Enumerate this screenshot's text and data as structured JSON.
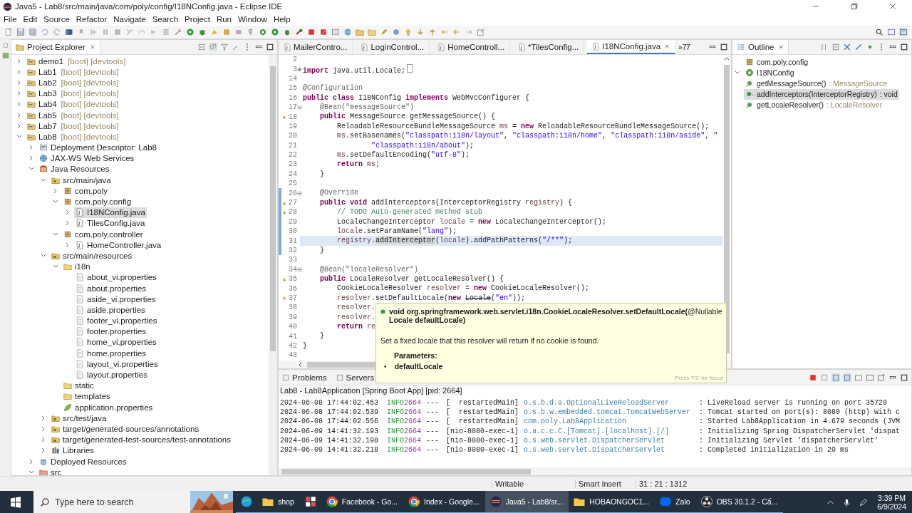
{
  "window": {
    "title": "Java5 - Lab8/src/main/java/com/poly/config/I18NConfig.java - Eclipse IDE"
  },
  "menu": [
    "File",
    "Edit",
    "Source",
    "Refactor",
    "Navigate",
    "Search",
    "Project",
    "Run",
    "Window",
    "Help"
  ],
  "explorer": {
    "title": "Project Explorer",
    "items": [
      {
        "label": "demo1",
        "decoration": "[boot] [devtools]",
        "kind": "project",
        "expanded": false,
        "selected": false
      },
      {
        "label": "Lab1",
        "decoration": "[boot] [devtools]",
        "kind": "project",
        "expanded": false,
        "selected": false
      },
      {
        "label": "Lab2",
        "decoration": "[boot] [devtools]",
        "kind": "project",
        "expanded": false,
        "selected": false
      },
      {
        "label": "Lab3",
        "decoration": "[boot] [devtools]",
        "kind": "project",
        "expanded": false,
        "selected": false
      },
      {
        "label": "Lab4",
        "decoration": "[boot] [devtools]",
        "kind": "project",
        "expanded": false,
        "selected": false
      },
      {
        "label": "Lab5",
        "decoration": "[boot] [devtools]",
        "kind": "project",
        "expanded": false,
        "selected": false
      },
      {
        "label": "Lab7",
        "decoration": "[boot] [devtools]",
        "kind": "project",
        "expanded": false,
        "selected": false
      },
      {
        "label": "Lab8",
        "decoration": "[boot] [devtools]",
        "kind": "project",
        "expanded": true,
        "selected": false,
        "children": [
          {
            "label": "Deployment Descriptor: Lab8",
            "kind": "descriptor",
            "expanded": false,
            "selected": false
          },
          {
            "label": "JAX-WS Web Services",
            "kind": "webservice",
            "expanded": false,
            "selected": false
          },
          {
            "label": "Java Resources",
            "kind": "javares",
            "expanded": true,
            "selected": false,
            "children": [
              {
                "label": "src/main/java",
                "kind": "srcfolder",
                "expanded": true,
                "selected": false,
                "children": [
                  {
                    "label": "com.poly",
                    "kind": "package",
                    "expanded": false,
                    "selected": false
                  },
                  {
                    "label": "com.poly.config",
                    "kind": "package",
                    "expanded": true,
                    "selected": false,
                    "children": [
                      {
                        "label": "I18NConfig.java",
                        "kind": "java",
                        "expanded": false,
                        "selected": true
                      },
                      {
                        "label": "TilesConfig.java",
                        "kind": "java",
                        "expanded": false,
                        "selected": false
                      }
                    ]
                  },
                  {
                    "label": "com.poly.controller",
                    "kind": "package",
                    "expanded": true,
                    "selected": false,
                    "children": [
                      {
                        "label": "HomeController.java",
                        "kind": "java",
                        "expanded": false,
                        "selected": false
                      }
                    ]
                  }
                ]
              },
              {
                "label": "src/main/resources",
                "kind": "srcfolder",
                "expanded": true,
                "selected": false,
                "children": [
                  {
                    "label": "i18n",
                    "kind": "folder",
                    "expanded": true,
                    "selected": false,
                    "children": [
                      {
                        "label": "about_vi.properties",
                        "kind": "file",
                        "selected": false
                      },
                      {
                        "label": "about.properties",
                        "kind": "file",
                        "selected": false
                      },
                      {
                        "label": "aside_vi.properties",
                        "kind": "file",
                        "selected": false
                      },
                      {
                        "label": "aside.properties",
                        "kind": "file",
                        "selected": false
                      },
                      {
                        "label": "footer_vi.properties",
                        "kind": "file",
                        "selected": false
                      },
                      {
                        "label": "footer.properties",
                        "kind": "file",
                        "selected": false
                      },
                      {
                        "label": "home_vi.properties",
                        "kind": "file",
                        "selected": false
                      },
                      {
                        "label": "home.properties",
                        "kind": "file",
                        "selected": false
                      },
                      {
                        "label": "layout_vi.properties",
                        "kind": "file",
                        "selected": false
                      },
                      {
                        "label": "layout.properties",
                        "kind": "file",
                        "selected": false
                      }
                    ]
                  },
                  {
                    "label": "static",
                    "kind": "folder",
                    "selected": false
                  },
                  {
                    "label": "templates",
                    "kind": "folder",
                    "selected": false
                  },
                  {
                    "label": "application.properties",
                    "kind": "leaf",
                    "selected": false
                  }
                ]
              },
              {
                "label": "src/test/java",
                "kind": "srcfolder",
                "expanded": false,
                "selected": false
              },
              {
                "label": "target/generated-sources/annotations",
                "kind": "srcfolder",
                "expanded": false,
                "selected": false
              },
              {
                "label": "target/generated-test-sources/test-annotations",
                "kind": "srcfolder",
                "expanded": false,
                "selected": false
              },
              {
                "label": "Libraries",
                "kind": "libraries",
                "expanded": false,
                "selected": false
              }
            ]
          },
          {
            "label": "Deployed Resources",
            "kind": "deployed",
            "expanded": false,
            "selected": false
          },
          {
            "label": "src",
            "kind": "src",
            "expanded": true,
            "selected": false
          }
        ]
      }
    ]
  },
  "editor": {
    "tabs": [
      {
        "label": "MailerContro...",
        "selected": false
      },
      {
        "label": "LoginControl...",
        "selected": false
      },
      {
        "label": "HomeControll...",
        "selected": false
      },
      {
        "label": "*TilesConfig...",
        "selected": false
      },
      {
        "label": "I18NConfig.java",
        "selected": true
      }
    ],
    "overflow": "»77",
    "lines": [
      {
        "num": "2",
        "changed": false,
        "flagged": false,
        "current": false
      },
      {
        "num": "3",
        "folded": true,
        "changed": false,
        "flagged": false,
        "current": false,
        "tokens": [
          {
            "kind": "kw",
            "text": "import"
          },
          {
            "kind": "plain",
            "text": " java.util.Locale;"
          }
        ]
      },
      {
        "num": "14",
        "changed": false,
        "flagged": false,
        "current": false
      },
      {
        "num": "15",
        "changed": false,
        "flagged": false,
        "current": false,
        "tokens": [
          {
            "kind": "ann",
            "text": "@Configuration"
          }
        ]
      },
      {
        "num": "16",
        "changed": false,
        "flagged": false,
        "current": false,
        "tokens": [
          {
            "kind": "kw",
            "text": "public class"
          },
          {
            "kind": "plain",
            "text": " I18NConfig "
          },
          {
            "kind": "kw",
            "text": "implements"
          },
          {
            "kind": "plain",
            "text": " WebMvcConfigurer {"
          }
        ]
      },
      {
        "num": "17",
        "folded": false,
        "changed": false,
        "flagged": false,
        "current": false,
        "tokens": [
          {
            "kind": "ann",
            "text": "    @Bean(\"messageSource\")"
          }
        ]
      },
      {
        "num": "18",
        "changed": false,
        "flagged": true,
        "current": false,
        "tokens": [
          {
            "kind": "kw",
            "text": "    public"
          },
          {
            "kind": "plain",
            "text": " MessageSource getMessageSource() {"
          }
        ]
      },
      {
        "num": "19",
        "changed": false,
        "flagged": false,
        "current": false,
        "tokens": [
          {
            "kind": "plain",
            "text": "        ReloadableResourceBundleMessageSource "
          },
          {
            "kind": "var",
            "text": "ms"
          },
          {
            "kind": "plain",
            "text": " = "
          },
          {
            "kind": "kw",
            "text": "new"
          },
          {
            "kind": "plain",
            "text": " ReloadableResourceBundleMessageSource();"
          }
        ]
      },
      {
        "num": "20",
        "changed": false,
        "flagged": false,
        "current": false,
        "tokens": [
          {
            "kind": "var",
            "text": "        ms"
          },
          {
            "kind": "plain",
            "text": ".setBasenames("
          },
          {
            "kind": "str",
            "text": "\"classpath:i18n/layout\""
          },
          {
            "kind": "plain",
            "text": ", "
          },
          {
            "kind": "str",
            "text": "\"classpath:i18n/home\""
          },
          {
            "kind": "plain",
            "text": ", "
          },
          {
            "kind": "str",
            "text": "\"classpath:i18n/aside\""
          },
          {
            "kind": "plain",
            "text": ", "
          },
          {
            "kind": "str",
            "text": "\""
          }
        ]
      },
      {
        "num": "21",
        "changed": false,
        "flagged": false,
        "current": false,
        "tokens": [
          {
            "kind": "str",
            "text": "                \"classpath:i18n/about\""
          },
          {
            "kind": "plain",
            "text": ");"
          }
        ]
      },
      {
        "num": "22",
        "changed": false,
        "flagged": false,
        "current": false,
        "tokens": [
          {
            "kind": "var",
            "text": "        ms"
          },
          {
            "kind": "plain",
            "text": ".setDefaultEncoding("
          },
          {
            "kind": "str",
            "text": "\"utf-8\""
          },
          {
            "kind": "plain",
            "text": ");"
          }
        ]
      },
      {
        "num": "23",
        "changed": false,
        "flagged": false,
        "current": false,
        "tokens": [
          {
            "kind": "kw",
            "text": "        return"
          },
          {
            "kind": "var",
            "text": " ms"
          },
          {
            "kind": "plain",
            "text": ";"
          }
        ]
      },
      {
        "num": "24",
        "changed": false,
        "flagged": false,
        "current": false,
        "tokens": [
          {
            "kind": "plain",
            "text": "    }"
          }
        ]
      },
      {
        "num": "25",
        "changed": false,
        "flagged": false,
        "current": false
      },
      {
        "num": "26",
        "folded": false,
        "changed": true,
        "flagged": false,
        "current": false,
        "tokens": [
          {
            "kind": "ann",
            "text": "    @Override"
          }
        ]
      },
      {
        "num": "27",
        "changed": true,
        "flagged": true,
        "current": false,
        "tokens": [
          {
            "kind": "kw",
            "text": "    public void"
          },
          {
            "kind": "plain",
            "text": " addInterceptors(InterceptorRegistry "
          },
          {
            "kind": "var",
            "text": "registry"
          },
          {
            "kind": "plain",
            "text": ") {"
          }
        ]
      },
      {
        "num": "28",
        "changed": true,
        "flagged": true,
        "current": false,
        "tokens": [
          {
            "kind": "cm",
            "text": "        // TODO Auto-generated method stub"
          }
        ]
      },
      {
        "num": "29",
        "changed": true,
        "flagged": false,
        "current": false,
        "tokens": [
          {
            "kind": "plain",
            "text": "        LocaleChangeInterceptor "
          },
          {
            "kind": "var",
            "text": "locale"
          },
          {
            "kind": "plain",
            "text": " = "
          },
          {
            "kind": "kw",
            "text": "new"
          },
          {
            "kind": "plain",
            "text": " LocaleChangeInterceptor();"
          }
        ]
      },
      {
        "num": "30",
        "changed": true,
        "flagged": false,
        "current": false,
        "tokens": [
          {
            "kind": "var",
            "text": "        locale"
          },
          {
            "kind": "plain",
            "text": ".setParamName("
          },
          {
            "kind": "str",
            "text": "\"lang\""
          },
          {
            "kind": "plain",
            "text": ");"
          }
        ]
      },
      {
        "num": "31",
        "changed": true,
        "flagged": false,
        "current": true,
        "tokens": [
          {
            "kind": "var",
            "text": "        registry"
          },
          {
            "kind": "plain",
            "text": "."
          },
          {
            "kind": "mark",
            "text": "addInterceptor"
          },
          {
            "kind": "plain",
            "text": "("
          },
          {
            "kind": "var",
            "text": "locale"
          },
          {
            "kind": "plain",
            "text": ").addPathPatterns("
          },
          {
            "kind": "str",
            "text": "\"/**\""
          },
          {
            "kind": "plain",
            "text": ");"
          }
        ]
      },
      {
        "num": "32",
        "changed": true,
        "flagged": false,
        "current": false,
        "tokens": [
          {
            "kind": "plain",
            "text": "    }"
          }
        ]
      },
      {
        "num": "33",
        "changed": false,
        "flagged": false,
        "current": false
      },
      {
        "num": "34",
        "folded": false,
        "changed": false,
        "flagged": false,
        "current": false,
        "tokens": [
          {
            "kind": "ann",
            "text": "    @Bean(\"localeResolver\")"
          }
        ]
      },
      {
        "num": "35",
        "changed": false,
        "flagged": true,
        "current": false,
        "tokens": [
          {
            "kind": "kw",
            "text": "    public"
          },
          {
            "kind": "plain",
            "text": " LocaleResolver getLocaleResolver() {"
          }
        ]
      },
      {
        "num": "36",
        "changed": false,
        "flagged": false,
        "current": false,
        "tokens": [
          {
            "kind": "plain",
            "text": "        CookieLocaleResolver "
          },
          {
            "kind": "var",
            "text": "resolver"
          },
          {
            "kind": "plain",
            "text": " = "
          },
          {
            "kind": "kw",
            "text": "new"
          },
          {
            "kind": "plain",
            "text": " CookieLocaleResolver();"
          }
        ]
      },
      {
        "num": "37",
        "changed": false,
        "flagged": true,
        "current": false,
        "tokens": [
          {
            "kind": "var",
            "text": "        resolver"
          },
          {
            "kind": "plain",
            "text": ".setDefaultLocale("
          },
          {
            "kind": "kw",
            "text": "new "
          },
          {
            "kind": "dep",
            "text": "Locale"
          },
          {
            "kind": "plain",
            "text": "("
          },
          {
            "kind": "str",
            "text": "\"en\""
          },
          {
            "kind": "plain",
            "text": "));"
          }
        ]
      },
      {
        "num": "38",
        "changed": false,
        "flagged": false,
        "current": false,
        "tokens": [
          {
            "kind": "var",
            "text": "        resolver"
          },
          {
            "kind": "plain",
            "text": "."
          }
        ]
      },
      {
        "num": "39",
        "changed": false,
        "flagged": false,
        "current": false,
        "tokens": [
          {
            "kind": "var",
            "text": "        resolver"
          },
          {
            "kind": "plain",
            "text": "."
          }
        ]
      },
      {
        "num": "40",
        "changed": false,
        "flagged": false,
        "current": false,
        "tokens": [
          {
            "kind": "kw",
            "text": "        return"
          },
          {
            "kind": "var",
            "text": " re"
          }
        ]
      },
      {
        "num": "41",
        "changed": false,
        "flagged": false,
        "current": false,
        "tokens": [
          {
            "kind": "plain",
            "text": "    }"
          }
        ]
      },
      {
        "num": "42",
        "changed": false,
        "flagged": false,
        "current": false,
        "tokens": [
          {
            "kind": "plain",
            "text": "}"
          }
        ]
      },
      {
        "num": "43",
        "changed": false,
        "flagged": false,
        "current": false
      }
    ]
  },
  "tooltip": {
    "signature": "**void org.springframework.web.servlet.i18n.CookieLocaleResolver.setDefaultLocale(**@Nullable **Locale defaultLocale)**",
    "description": "Set a fixed locale that this resolver will return if no cookie is found.",
    "params_heading": "Parameters:",
    "params": [
      {
        "bullet": "•",
        "name": "defaultLocale"
      }
    ],
    "hint": "Press 'F2' for focus"
  },
  "outline": {
    "title": "Outline",
    "items": [
      {
        "label": "com.poly.config",
        "kind": "package",
        "selected": false
      },
      {
        "label": "I18NConfig",
        "kind": "class",
        "expanded": true,
        "selected": false,
        "children": [
          {
            "label": "getMessageSource()",
            "type": " : MessageSource",
            "kind": "method",
            "selected": false
          },
          {
            "label": "addInterceptors(InterceptorRegistry)",
            "type": " : void",
            "kind": "method-public",
            "selected": true
          },
          {
            "label": "getLocaleResolver()",
            "type": " : LocaleResolver",
            "kind": "method",
            "selected": false
          }
        ]
      }
    ]
  },
  "console": {
    "tabs": [
      {
        "label": "Problems",
        "selected": false
      },
      {
        "label": "Servers",
        "selected": false
      }
    ],
    "process": "Lab8 - Lab8Application [Spring Boot App]  [pid: 2664]",
    "rows": [
      {
        "date": "2024-06-08 17:44:02.453",
        "level": "INFO",
        "pid": "2664",
        "sep": "---",
        "thread": "[  restartedMain]",
        "logger": "o.s.b.d.a.OptionalLiveReloadServer",
        "message": ": LiveReload server is running on port 35729"
      },
      {
        "date": "2024-06-08 17:44:02.539",
        "level": "INFO",
        "pid": "2664",
        "sep": "---",
        "thread": "[  restartedMain]",
        "logger": "o.s.b.w.embedded.tomcat.TomcatWebServer",
        "message": ": Tomcat started on port(s): 8080 (http) with c"
      },
      {
        "date": "2024-06-08 17:44:02.556",
        "level": "INFO",
        "pid": "2664",
        "sep": "---",
        "thread": "[  restartedMain]",
        "logger": "com.poly.Lab8Application",
        "message": ": Started Lab8Application in 4.679 seconds (JVM"
      },
      {
        "date": "2024-06-09 14:41:32.193",
        "level": "INFO",
        "pid": "2664",
        "sep": "---",
        "thread": "[nio-8080-exec-1]",
        "logger": "o.a.c.c.C.[Tomcat].[localhost].[/]",
        "message": ": Initializing Spring DispatcherServlet 'dispat"
      },
      {
        "date": "2024-06-09 14:41:32.198",
        "level": "INFO",
        "pid": "2664",
        "sep": "---",
        "thread": "[nio-8080-exec-1]",
        "logger": "o.s.web.servlet.DispatcherServlet",
        "message": ": Initializing Servlet 'dispatcherServlet'"
      },
      {
        "date": "2024-06-09 14:41:32.218",
        "level": "INFO",
        "pid": "2664",
        "sep": "---",
        "thread": "[nio-8080-exec-1]",
        "logger": "o.s.web.servlet.DispatcherServlet",
        "message": ": Completed initialization in 20 ms"
      }
    ]
  },
  "status_bar": {
    "mode": "Writable",
    "insert": "Smart Insert",
    "position": "31 : 21 : 1312"
  },
  "taskbar": {
    "search": {
      "placeholder": "Type here to search"
    },
    "items": [
      {
        "kind": "edge",
        "active": false
      },
      {
        "kind": "folder",
        "label": "shop",
        "active": false
      },
      {
        "kind": "grid",
        "active": false
      },
      {
        "kind": "chrome",
        "label": "Facebook - Go...",
        "active": false
      },
      {
        "kind": "chrome",
        "label": "Index - Google...",
        "active": false
      },
      {
        "kind": "eclipse",
        "label": "Java5 - Lab8/sr...",
        "active": true
      },
      {
        "kind": "folder",
        "label": "HOBAONGOC1...",
        "active": false
      },
      {
        "kind": "zalo",
        "label": "Zalo",
        "active": false
      },
      {
        "kind": "obs",
        "label": "OBS 30.1.2 - Cấ...",
        "active": false
      }
    ],
    "time": "3:39 PM",
    "date": "6/9/2024"
  }
}
